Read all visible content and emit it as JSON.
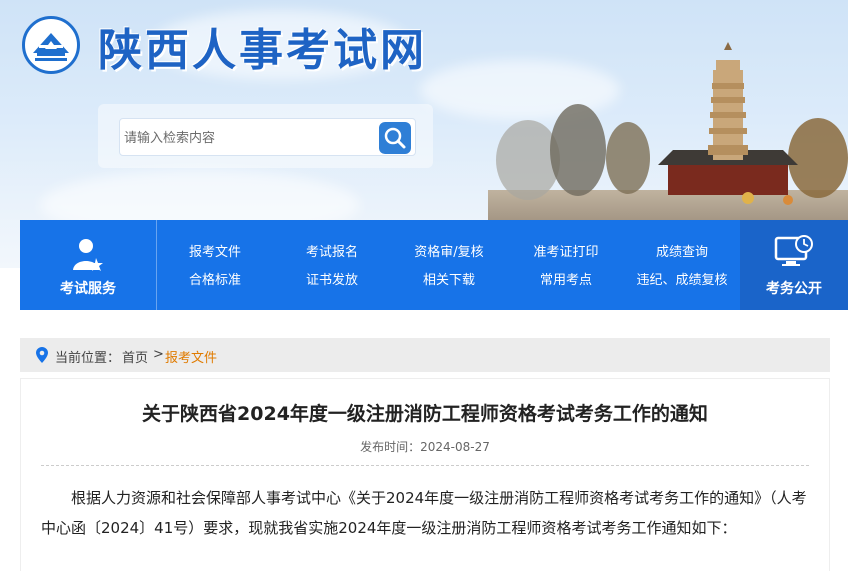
{
  "header": {
    "site_title": "陕西人事考试网",
    "search_placeholder": "请输入检索内容"
  },
  "nav": {
    "left_label": "考试服务",
    "right_label": "考务公开",
    "links": [
      {
        "label": "报考文件"
      },
      {
        "label": "考试报名"
      },
      {
        "label": "资格审/复核"
      },
      {
        "label": "准考证打印"
      },
      {
        "label": "成绩查询"
      },
      {
        "label": "合格标准"
      },
      {
        "label": "证书发放"
      },
      {
        "label": "相关下载"
      },
      {
        "label": "常用考点"
      },
      {
        "label": "违纪、成绩复核"
      }
    ]
  },
  "breadcrumb": {
    "prefix": "当前位置：",
    "home": "首页",
    "separator": ">",
    "current": "报考文件"
  },
  "article": {
    "title": "关于陕西省2024年度一级注册消防工程师资格考试考务工作的通知",
    "date": "发布时间：2024-08-27",
    "body": "根据人力资源和社会保障部人事考试中心《关于2024年度一级注册消防工程师资格考试考务工作的通知》（人考中心函〔2024〕41号）要求，现就我省实施2024年度一级注册消防工程师资格考试考务工作通知如下："
  },
  "colors": {
    "brand_blue": "#1773e8",
    "breadcrumb_current": "#e07b00"
  }
}
